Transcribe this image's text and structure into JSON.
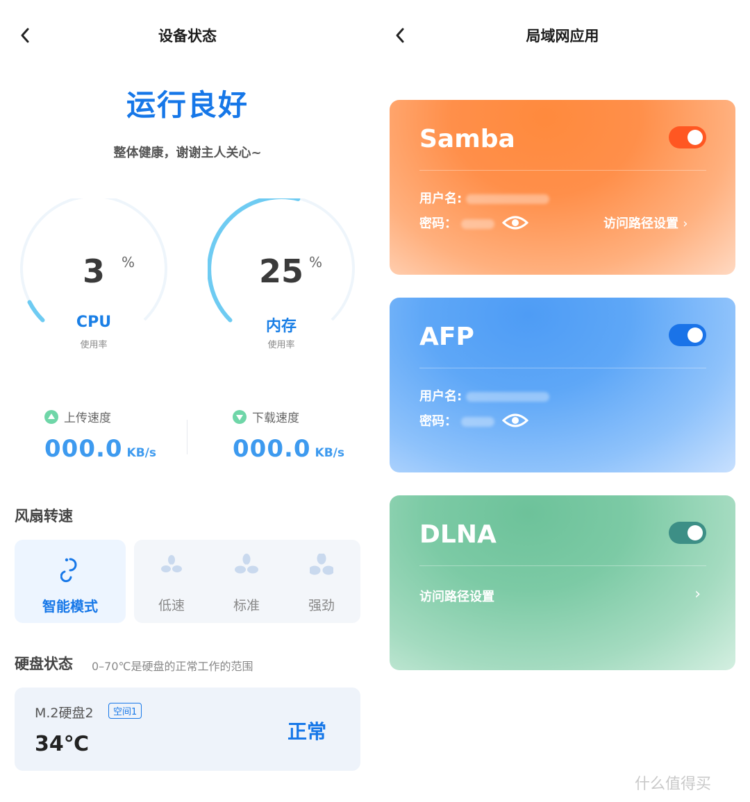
{
  "left": {
    "title": "设备状态",
    "status_title": "运行良好",
    "status_subtitle": "整体健康，谢谢主人关心~",
    "gauges": [
      {
        "value": "3",
        "unit": "%",
        "label": "CPU",
        "sub": "使用率",
        "percent": 3
      },
      {
        "value": "25",
        "unit": "%",
        "label": "内存",
        "sub": "使用率",
        "percent": 25
      }
    ],
    "upload": {
      "label": "上传速度",
      "value": "000.0",
      "unit": "KB/s"
    },
    "download": {
      "label": "下载速度",
      "value": "000.0",
      "unit": "KB/s"
    },
    "fan": {
      "title": "风扇转速",
      "smart_label": "智能模式",
      "options": [
        "低速",
        "标准",
        "强劲"
      ]
    },
    "disk": {
      "title": "硬盘状态",
      "hint": "0–70℃是硬盘的正常工作的范围",
      "name": "M.2硬盘2",
      "tag": "空间1",
      "temp": "34℃",
      "status": "正常"
    }
  },
  "right": {
    "title": "局域网应用",
    "cards": [
      {
        "name": "Samba",
        "user_label": "用户名:",
        "password_label": "密码：",
        "link": "访问路径设置",
        "enabled": true,
        "accent": "#ff5722"
      },
      {
        "name": "AFP",
        "user_label": "用户名:",
        "password_label": "密码：",
        "enabled": true,
        "accent": "#1a73e8"
      },
      {
        "name": "DLNA",
        "link": "访问路径设置",
        "enabled": true,
        "accent": "#3d8f86"
      }
    ]
  },
  "watermark": "什么值得买",
  "colors": {
    "primary": "#1677e8",
    "gauge": "#6ecbf2",
    "speed": "#3d9aef"
  },
  "icons": [
    "back-chevron-icon",
    "up-arrow-icon",
    "down-arrow-icon",
    "fan-icon",
    "smart-mode-icon",
    "eye-icon",
    "chevron-right-icon"
  ]
}
